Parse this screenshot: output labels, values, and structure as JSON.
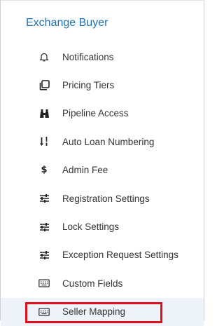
{
  "section": {
    "title": "Exchange Buyer"
  },
  "menu": {
    "items": [
      {
        "label": "Notifications",
        "icon": "bell-icon"
      },
      {
        "label": "Pricing Tiers",
        "icon": "copy-icon"
      },
      {
        "label": "Pipeline Access",
        "icon": "binoculars-icon"
      },
      {
        "label": "Auto Loan Numbering",
        "icon": "sort-numeric-icon"
      },
      {
        "label": "Admin Fee",
        "icon": "dollar-icon"
      },
      {
        "label": "Registration Settings",
        "icon": "sliders-icon"
      },
      {
        "label": "Lock Settings",
        "icon": "sliders-icon"
      },
      {
        "label": "Exception Request Settings",
        "icon": "sliders-icon"
      },
      {
        "label": "Custom Fields",
        "icon": "keyboard-icon"
      },
      {
        "label": "Seller Mapping",
        "icon": "keyboard-icon",
        "selected": true
      }
    ]
  },
  "colors": {
    "accent": "#1f6fb5",
    "highlight": "#e0101e",
    "selected_bg": "#eef3f9"
  }
}
